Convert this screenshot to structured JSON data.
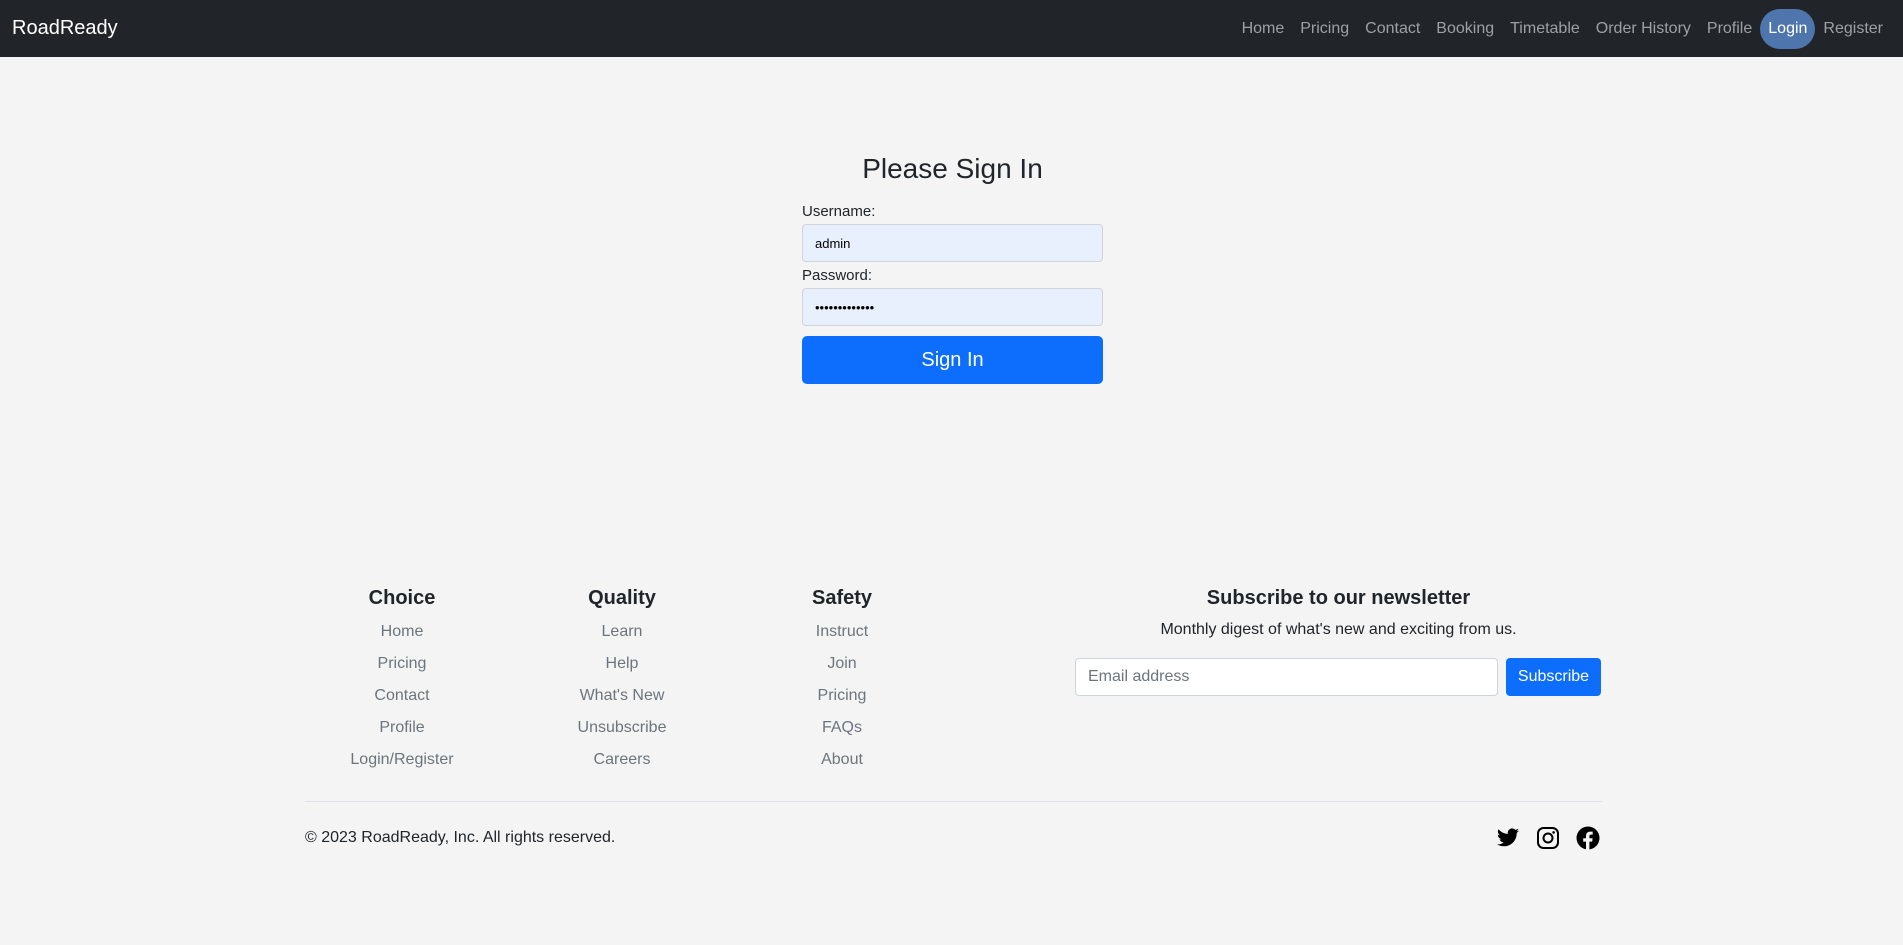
{
  "navbar": {
    "brand": "RoadReady",
    "links": [
      {
        "label": "Home"
      },
      {
        "label": "Pricing"
      },
      {
        "label": "Contact"
      },
      {
        "label": "Booking"
      },
      {
        "label": "Timetable"
      },
      {
        "label": "Order History"
      },
      {
        "label": "Profile"
      },
      {
        "label": "Login",
        "active": true
      },
      {
        "label": "Register"
      }
    ]
  },
  "signin": {
    "title": "Please Sign In",
    "username_label": "Username:",
    "username_value": "admin",
    "password_label": "Password:",
    "password_value": "•••••••••••••",
    "button": "Sign In"
  },
  "footer": {
    "columns": [
      {
        "title": "Choice",
        "links": [
          "Home",
          "Pricing",
          "Contact",
          "Profile",
          "Login/Register"
        ]
      },
      {
        "title": "Quality",
        "links": [
          "Learn",
          "Help",
          "What's New",
          "Unsubscribe",
          "Careers"
        ]
      },
      {
        "title": "Safety",
        "links": [
          "Instruct",
          "Join",
          "Pricing",
          "FAQs",
          "About"
        ]
      }
    ],
    "newsletter": {
      "title": "Subscribe to our newsletter",
      "text": "Monthly digest of what's new and exciting from us.",
      "placeholder": "Email address",
      "button": "Subscribe"
    },
    "copyright": "© 2023 RoadReady, Inc. All rights reserved.",
    "social": [
      "twitter-icon",
      "instagram-icon",
      "facebook-icon"
    ]
  },
  "colors": {
    "navbar_bg": "#212529",
    "primary": "#0d6efd",
    "active_pill": "#4f75ad",
    "page_bg": "#f4f4f4"
  }
}
